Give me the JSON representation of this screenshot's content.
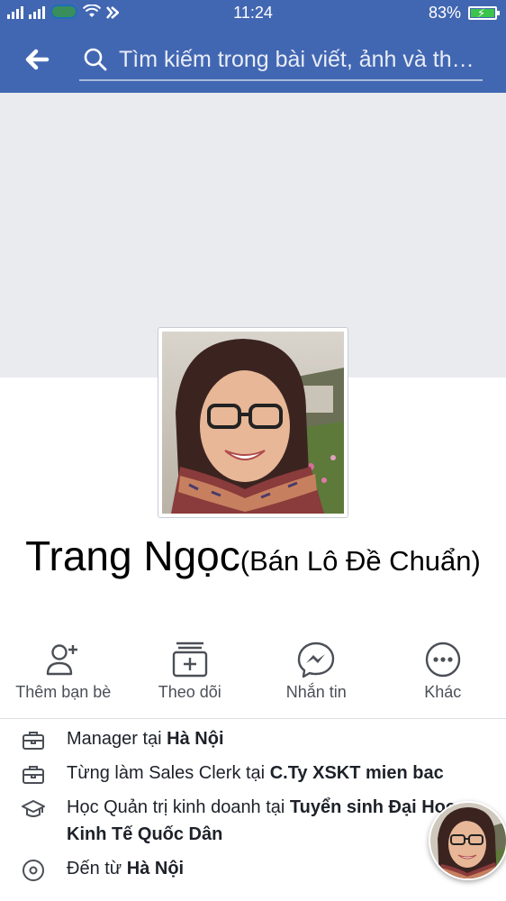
{
  "status_bar": {
    "time": "11:24",
    "battery": "83%"
  },
  "header": {
    "back_icon": "arrow-left-icon",
    "search_icon": "search-icon",
    "search_placeholder": "Tìm kiếm trong bài viết, ảnh và thẻ..."
  },
  "profile": {
    "name": "Trang Ngọc",
    "nickname": "(Bán Lô Đề Chuẩn)"
  },
  "actions": [
    {
      "icon": "add-friend-icon",
      "label": "Thêm bạn bè"
    },
    {
      "icon": "follow-icon",
      "label": "Theo dõi"
    },
    {
      "icon": "messenger-icon",
      "label": "Nhắn tin"
    },
    {
      "icon": "more-icon",
      "label": "Khác"
    }
  ],
  "info": [
    {
      "icon": "briefcase-icon",
      "prefix": "Manager tại ",
      "bold": "Hà Nội"
    },
    {
      "icon": "briefcase-icon",
      "prefix": "Từng làm Sales Clerk tại ",
      "bold": "C.Ty XSKT mien bac"
    },
    {
      "icon": "graduation-cap-icon",
      "prefix": "Học Quản trị kinh doanh tại ",
      "bold": "Tuyển sinh Đại Học Kinh Tế Quốc Dân"
    },
    {
      "icon": "location-pin-icon",
      "prefix": "Đến từ ",
      "bold": "Hà Nội"
    }
  ],
  "colors": {
    "header_bg": "#4267b2",
    "cover_bg": "#e9ebee",
    "icon_gray": "#4b4f56"
  }
}
